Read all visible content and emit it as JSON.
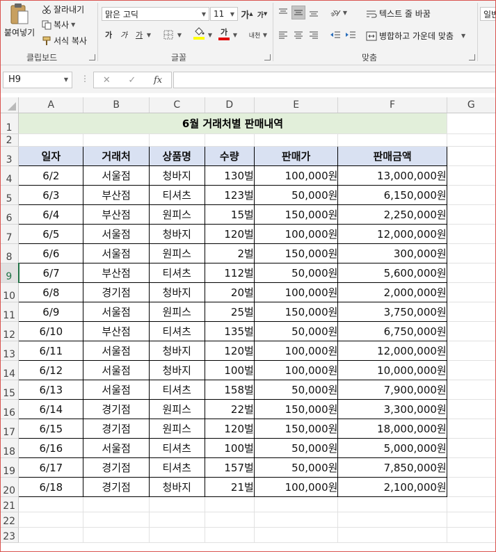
{
  "ribbon": {
    "clipboard": {
      "paste_label": "붙여넣기",
      "cut_label": "잘라내기",
      "copy_label": "복사",
      "format_painter_label": "서식 복사",
      "group_label": "클립보드"
    },
    "font": {
      "font_name": "맑은 고딕",
      "font_size": "11",
      "grow_label": "가",
      "shrink_label": "가",
      "bold_label": "가",
      "italic_label": "가",
      "underline_label": "가",
      "font_color_label": "가",
      "phonetic_label": "내천",
      "group_label": "글꼴",
      "highlight_color": "#ffff00",
      "font_color": "#e00000"
    },
    "alignment": {
      "wrap_text_label": "텍스트 줄 바꿈",
      "merge_center_label": "병합하고 가운데 맞춤",
      "group_label": "맞춤"
    },
    "number": {
      "format_label": "일반"
    }
  },
  "formula_bar": {
    "name_box": "H9",
    "fx_label": "fx",
    "formula": ""
  },
  "sheet": {
    "columns": [
      "A",
      "B",
      "C",
      "D",
      "E",
      "F",
      "G"
    ],
    "selected_row": "9",
    "title": "6월  거래처별 판매내역",
    "headers": [
      "일자",
      "거래처",
      "상품명",
      "수량",
      "판매가",
      "판매금액"
    ],
    "rows": [
      [
        "6/2",
        "서울점",
        "청바지",
        "130벌",
        "100,000원",
        "13,000,000원"
      ],
      [
        "6/3",
        "부산점",
        "티셔츠",
        "123벌",
        "50,000원",
        "6,150,000원"
      ],
      [
        "6/4",
        "부산점",
        "원피스",
        "15벌",
        "150,000원",
        "2,250,000원"
      ],
      [
        "6/5",
        "서울점",
        "청바지",
        "120벌",
        "100,000원",
        "12,000,000원"
      ],
      [
        "6/6",
        "서울점",
        "원피스",
        "2벌",
        "150,000원",
        "300,000원"
      ],
      [
        "6/7",
        "부산점",
        "티셔츠",
        "112벌",
        "50,000원",
        "5,600,000원"
      ],
      [
        "6/8",
        "경기점",
        "청바지",
        "20벌",
        "100,000원",
        "2,000,000원"
      ],
      [
        "6/9",
        "서울점",
        "원피스",
        "25벌",
        "150,000원",
        "3,750,000원"
      ],
      [
        "6/10",
        "부산점",
        "티셔츠",
        "135벌",
        "50,000원",
        "6,750,000원"
      ],
      [
        "6/11",
        "서울점",
        "청바지",
        "120벌",
        "100,000원",
        "12,000,000원"
      ],
      [
        "6/12",
        "서울점",
        "청바지",
        "100벌",
        "100,000원",
        "10,000,000원"
      ],
      [
        "6/13",
        "서울점",
        "티셔츠",
        "158벌",
        "50,000원",
        "7,900,000원"
      ],
      [
        "6/14",
        "경기점",
        "원피스",
        "22벌",
        "150,000원",
        "3,300,000원"
      ],
      [
        "6/15",
        "경기점",
        "원피스",
        "120벌",
        "150,000원",
        "18,000,000원"
      ],
      [
        "6/16",
        "서울점",
        "티셔츠",
        "100벌",
        "50,000원",
        "5,000,000원"
      ],
      [
        "6/17",
        "경기점",
        "티셔츠",
        "157벌",
        "50,000원",
        "7,850,000원"
      ],
      [
        "6/18",
        "경기점",
        "청바지",
        "21벌",
        "100,000원",
        "2,100,000원"
      ]
    ],
    "title_fill": "#e2efda",
    "header_fill": "#d9e1f2"
  }
}
